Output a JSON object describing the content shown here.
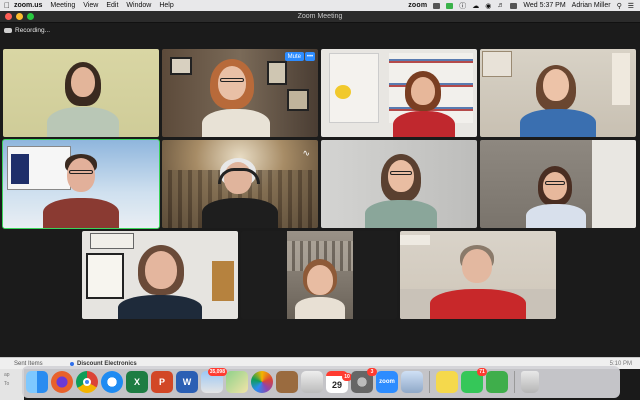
{
  "menubar": {
    "app_name": "zoom.us",
    "menus": [
      "Meeting",
      "View",
      "Edit",
      "Window",
      "Help"
    ],
    "status_zoom_label": "zoom",
    "clock": "Wed 5:37 PM",
    "user_name": "Adrian Miller"
  },
  "window": {
    "title": "Zoom Meeting",
    "recording_label": "Recording..."
  },
  "active_tile": {
    "mute_label": "Mute",
    "more_label": "•••"
  },
  "mail": {
    "folder_label": "Sent Items",
    "subject": "Discount Electronics",
    "time": "5:10 PM",
    "side_labels": [
      "ap",
      "To"
    ]
  },
  "dock": {
    "icons": [
      {
        "name": "finder",
        "color": "#2a8cf0"
      },
      {
        "name": "firefox",
        "color": "#e8612c"
      },
      {
        "name": "chrome",
        "color": "#f4f4f4"
      },
      {
        "name": "safari",
        "color": "#1f8bf2"
      },
      {
        "name": "excel",
        "color": "#1e7d43",
        "glyph": "X"
      },
      {
        "name": "powerpoint",
        "color": "#d24726",
        "glyph": "P"
      },
      {
        "name": "word",
        "color": "#2b5fb4",
        "glyph": "W"
      },
      {
        "name": "mail",
        "color": "#e5e5e5",
        "badge": "35,098"
      },
      {
        "name": "maps",
        "color": "#5ab55e"
      },
      {
        "name": "photos",
        "color": "#f6f6f6"
      },
      {
        "name": "notes-book",
        "color": "#9a6b3f"
      },
      {
        "name": "scanner",
        "color": "#d8d8d8"
      },
      {
        "name": "calendar",
        "color": "#ffffff",
        "glyph": "29",
        "badge": "10"
      },
      {
        "name": "system-preferences",
        "color": "#777777",
        "badge": "3"
      },
      {
        "name": "zoom",
        "color": "#2d8cff",
        "glyph": "zoom"
      },
      {
        "name": "preview",
        "color": "#b0c4de"
      },
      {
        "name": "stickies",
        "color": "#f5d94c"
      },
      {
        "name": "facetime",
        "color": "#35c759",
        "badge": "71"
      },
      {
        "name": "numbers",
        "color": "#3fae4b"
      },
      {
        "name": "trash",
        "color": "#cfcfcf"
      }
    ]
  }
}
